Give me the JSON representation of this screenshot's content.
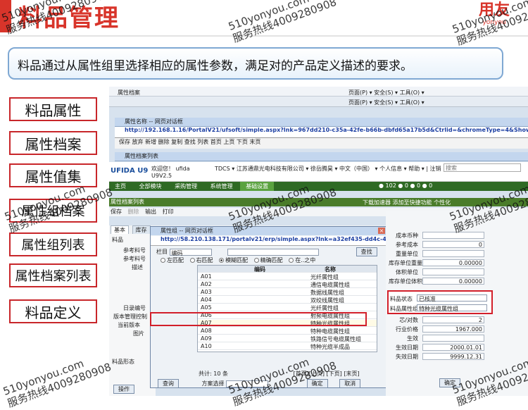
{
  "slide": {
    "title": "料品管理",
    "logo_main": "用友",
    "logo_sub": "yonyou",
    "intro": "料品通过从属性组里选择相应的属性参数，满足对的产品定义描述的要求。"
  },
  "labels": [
    "料品属性",
    "属性档案",
    "属性值集",
    "属性组档案",
    "属性组列表",
    "属性档案列表",
    "料品定义"
  ],
  "watermark": {
    "line1": "510yonyou.com",
    "line2": "服务热线4009280908"
  },
  "browser": {
    "tab_text": "属性档案",
    "ie_tools": "页面(P) ▾  安全(S) ▾  工具(O) ▾",
    "page_tab": "属性档案列表"
  },
  "dialog1": {
    "title": "属性名称 -- 网页对话框",
    "url": "http://192.168.1.16/PortalV21/ufsoft/simple.aspx?lnk=967dd210-c35a-42fe-b66b-dbfd65a17b5d&Ctrlid=&chromeType=4&ShowType=TitleLink&ID=1001110160935027",
    "toolbar": "保存  放弃  新增  删除  复制  查找  列表  首页  上页  下页  末页"
  },
  "u9": {
    "brand": "UFIDA U9",
    "version": "U9V2.5",
    "welcome": "欢迎您！ ufida",
    "header_links": "TDCS ▾  江苏通鼎光电科技有限公司 ▾  徐岳腾昊 ▾  中文（中国） ▾  个人信息 ▾  帮助 ▾ | 注销",
    "search_placeholder": "搜索",
    "nav": [
      "主页",
      "全部模块",
      "采购管理",
      "系统管理",
      "基础设置"
    ],
    "counters": "● 102   ● 0   ● 0   ● 0",
    "module_title": "属性档案列表",
    "module_links": "下载加速器   添加至快捷功能   个性化",
    "toolbar": [
      "保存",
      "删除",
      "输出",
      "打印"
    ],
    "tabs": [
      "基本",
      "库存"
    ],
    "left_fields": [
      "料品",
      "参考料号",
      "参考料号",
      "描述",
      "日录编号",
      "版本管理控制",
      "当前版本",
      "图片",
      "料品形态"
    ],
    "action_button": "操作"
  },
  "inner_dialog": {
    "title": "属性组 -- 网页对话框",
    "url": "http://58.210.138.171/portalv21/erp/simple.aspx?lnk=a32ef435-dd4c-48b4-a30b-27841d244983",
    "filter_field": "编码",
    "filter_label": "栏目",
    "search_button": "查找",
    "match_options": [
      "左匹配",
      "右匹配",
      "模糊匹配",
      "精确匹配",
      "在..之中"
    ],
    "selected_option": 2,
    "col_code": "编码",
    "col_name": "名称",
    "rows": [
      {
        "code": "A01",
        "name": "光纤属性组"
      },
      {
        "code": "A02",
        "name": "通信电缆属性组"
      },
      {
        "code": "A03",
        "name": "数据线属性组"
      },
      {
        "code": "A04",
        "name": "双绞线属性组"
      },
      {
        "code": "A05",
        "name": "光纤属性组"
      },
      {
        "code": "A06",
        "name": "射频电缆属性组"
      },
      {
        "code": "A07",
        "name": "特种光缆属性组"
      },
      {
        "code": "A08",
        "name": "特种电缆属性组"
      },
      {
        "code": "A09",
        "name": "铁路信号电缆属性组"
      },
      {
        "code": "A10",
        "name": "特种光缆半成品"
      }
    ],
    "highlighted_row": 6,
    "total": "共计: 10 条",
    "pager": "[首页][上页]  [下页]  [末页]",
    "query_button": "查询",
    "scheme_label": "方案选择",
    "ok_button": "确定",
    "cancel_button": "取消"
  },
  "right_panel": {
    "fields": [
      {
        "label": "成本币种",
        "value": ""
      },
      {
        "label": "参考成本",
        "value": "0"
      },
      {
        "label": "重量单位",
        "value": ""
      },
      {
        "label": "库存单位重量",
        "value": "0.00000"
      },
      {
        "label": "体积单位",
        "value": ""
      },
      {
        "label": "库存单位体积",
        "value": "0.00000"
      }
    ],
    "status_label": "料品状态",
    "status_value": "已核准",
    "group_label": "料品属性组",
    "group_value": "特种光缆属性组",
    "bottom_fields": [
      {
        "label": "芯/对数",
        "value": "2"
      },
      {
        "label": "行业价格",
        "value": "1967.000"
      },
      {
        "label": "生效",
        "value": ""
      },
      {
        "label": "生效日期",
        "value": "2000.01.01"
      },
      {
        "label": "失效日期",
        "value": "9999.12.31"
      }
    ],
    "ok_button": "确定"
  }
}
